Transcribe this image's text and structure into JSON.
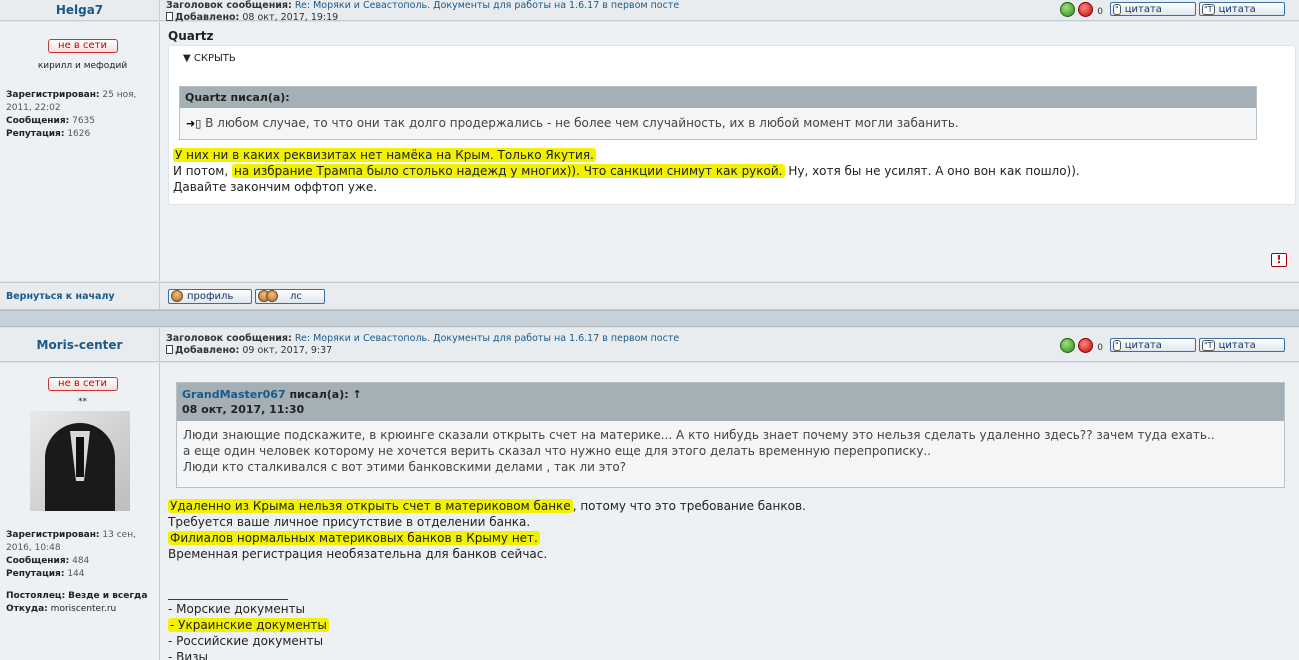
{
  "post1": {
    "author": "Helga7",
    "subject_label": "Заголовок сообщения:",
    "subject_link": "Re: Моряки и Севастополь. Документы для работы на 1.6.17 в первом посте",
    "added_label": "Добавлено:",
    "added_date": "08 окт, 2017, 19:19",
    "vote_count": "0",
    "quote_btn_1": "цитата",
    "quote_btn_2": "цитата",
    "status": "не в сети",
    "user_title": "кирилл и мефодий",
    "registered_label": "Зарегистрирован:",
    "registered_value": "25 ноя, 2011, 22:02",
    "messages_label": "Сообщения:",
    "messages_value": "7635",
    "reputation_label": "Репутация:",
    "reputation_value": "1626",
    "body_subject": "Quartz",
    "spoiler_label": "▼ СКРЫТЬ",
    "quote_author": "Quartz писал(а):",
    "quote_text": "В любом случае, то что они так долго продержались - не более чем случайность, их в любой момент могли забанить.",
    "line1": "У них ни в каких реквизитах нет намёка на Крым. Только Якутия.",
    "line2_a": "И потом, ",
    "line2_hl": "на избрание Трампа было столько надежд у многих)). Что санкции снимут как рукой.",
    "line2_b": " Ну, хотя бы не усилят. А оно вон как пошло)).",
    "line3": "Давайте закончим оффтоп уже.",
    "alert": "!"
  },
  "footer": {
    "back_to_top": "Вернуться к началу",
    "profile_btn": "профиль",
    "pm_btn": "лс"
  },
  "post2": {
    "author": "Moris-center",
    "subject_label": "Заголовок сообщения:",
    "subject_link": "Re: Моряки и Севастополь. Документы для работы на 1.6.17 в первом посте",
    "added_label": "Добавлено:",
    "added_date": "09 окт, 2017, 9:37",
    "vote_count": "0",
    "quote_btn_1": "цитата",
    "quote_btn_2": "цитата",
    "status": "не в сети",
    "user_title": "**",
    "registered_label": "Зарегистрирован:",
    "registered_value": "13 сен, 2016, 10:48",
    "messages_label": "Сообщения:",
    "messages_value": "484",
    "reputation_label": "Репутация:",
    "reputation_value": "144",
    "location_label": "Постоялец:",
    "location_value": "Везде и всегда",
    "from_label": "Откуда:",
    "from_value": "moriscenter.ru",
    "quote_author": "GrandMaster067",
    "quote_wrote": " писал(а): ↑",
    "quote_date": "08 окт, 2017, 11:30",
    "quote_l1": "Люди знающие подскажите, в крюинге сказали открыть счет на материке... А кто нибудь знает почему это нельзя сделать удаленно здесь?? зачем туда ехать..",
    "quote_l2": "а еще один человек которому не хочется верить сказал что нужно еще для этого делать временную перепрописку..",
    "quote_l3": "Люди кто сталкивался с вот этими банковскими делами , так ли это?",
    "l1_hl": "Удаленно из Крыма нельзя открыть счет в материковом банке",
    "l1_b": ", потому что это требование банков.",
    "l2": "Требуется ваше личное присутствие в отделении банка.",
    "l3_hl": "Филиалов нормальных материковых банков в Крыму нет.",
    "l4": "Временная регистрация необязательна для банков сейчас.",
    "sig_line": "____________________",
    "sig_1": "- Морские документы",
    "sig_2": "- Украинские документы",
    "sig_3": "- Российские документы",
    "sig_4": "- Визы"
  }
}
